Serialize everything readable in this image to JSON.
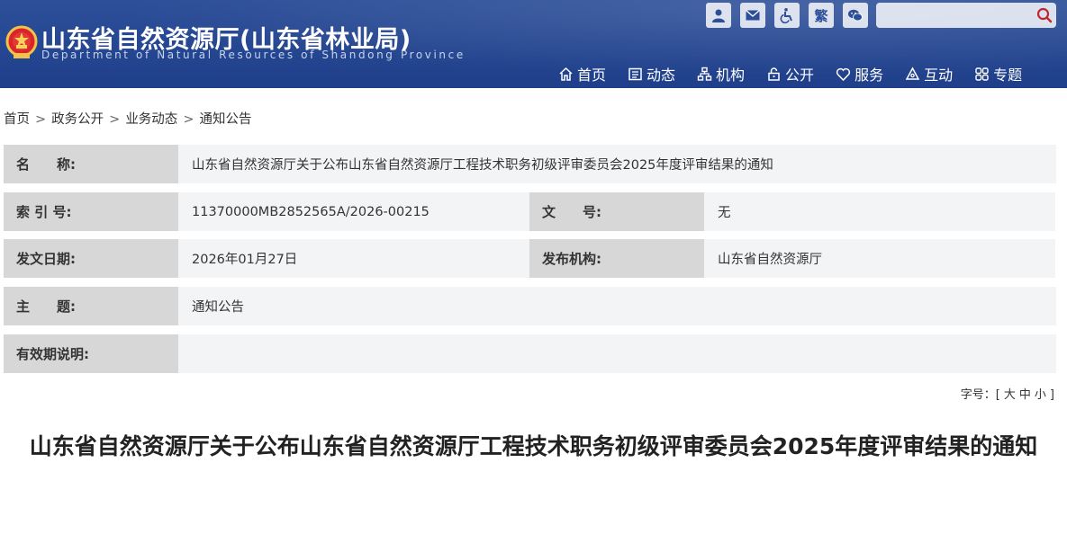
{
  "header": {
    "title": "山东省自然资源厅(山东省林业局)",
    "subtitle": "Department of Natural Resources of Shandong Province",
    "top_icons": [
      "user-icon",
      "mail-icon",
      "accessibility-icon",
      "traditional-chinese-icon",
      "wechat-icon"
    ],
    "traditional_label": "繁",
    "search": {
      "placeholder": ""
    },
    "nav": [
      {
        "label": "首页",
        "icon": "home-icon"
      },
      {
        "label": "动态",
        "icon": "news-icon"
      },
      {
        "label": "机构",
        "icon": "org-icon"
      },
      {
        "label": "公开",
        "icon": "lock-icon"
      },
      {
        "label": "服务",
        "icon": "heart-icon"
      },
      {
        "label": "互动",
        "icon": "interact-icon"
      },
      {
        "label": "专题",
        "icon": "grid-icon"
      }
    ],
    "colors": {
      "header_bg": "#2d4f99",
      "search_icon": "#c0262d"
    }
  },
  "breadcrumb": [
    "首页",
    "政务公开",
    "业务动态",
    "通知公告"
  ],
  "meta": {
    "name_label": "名　　称:",
    "name_value": "山东省自然资源厅关于公布山东省自然资源厅工程技术职务初级评审委员会2025年度评审结果的通知",
    "index_label": "索 引 号:",
    "index_value": "11370000MB2852565A/2026-00215",
    "doc_no_label": "文　　号:",
    "doc_no_value": "无",
    "date_label": "发文日期:",
    "date_value": "2026年01月27日",
    "publisher_label": "发布机构:",
    "publisher_value": "山东省自然资源厅",
    "topic_label": "主　　题:",
    "topic_value": "通知公告",
    "validity_label": "有效期说明:",
    "validity_value": ""
  },
  "font_size": {
    "prefix": "字号：[",
    "large": "大",
    "medium": "中",
    "small": "小",
    "suffix": "]"
  },
  "article": {
    "title": "山东省自然资源厅关于公布山东省自然资源厅工程技术职务初级评审委员会2025年度评审结果的通知"
  }
}
